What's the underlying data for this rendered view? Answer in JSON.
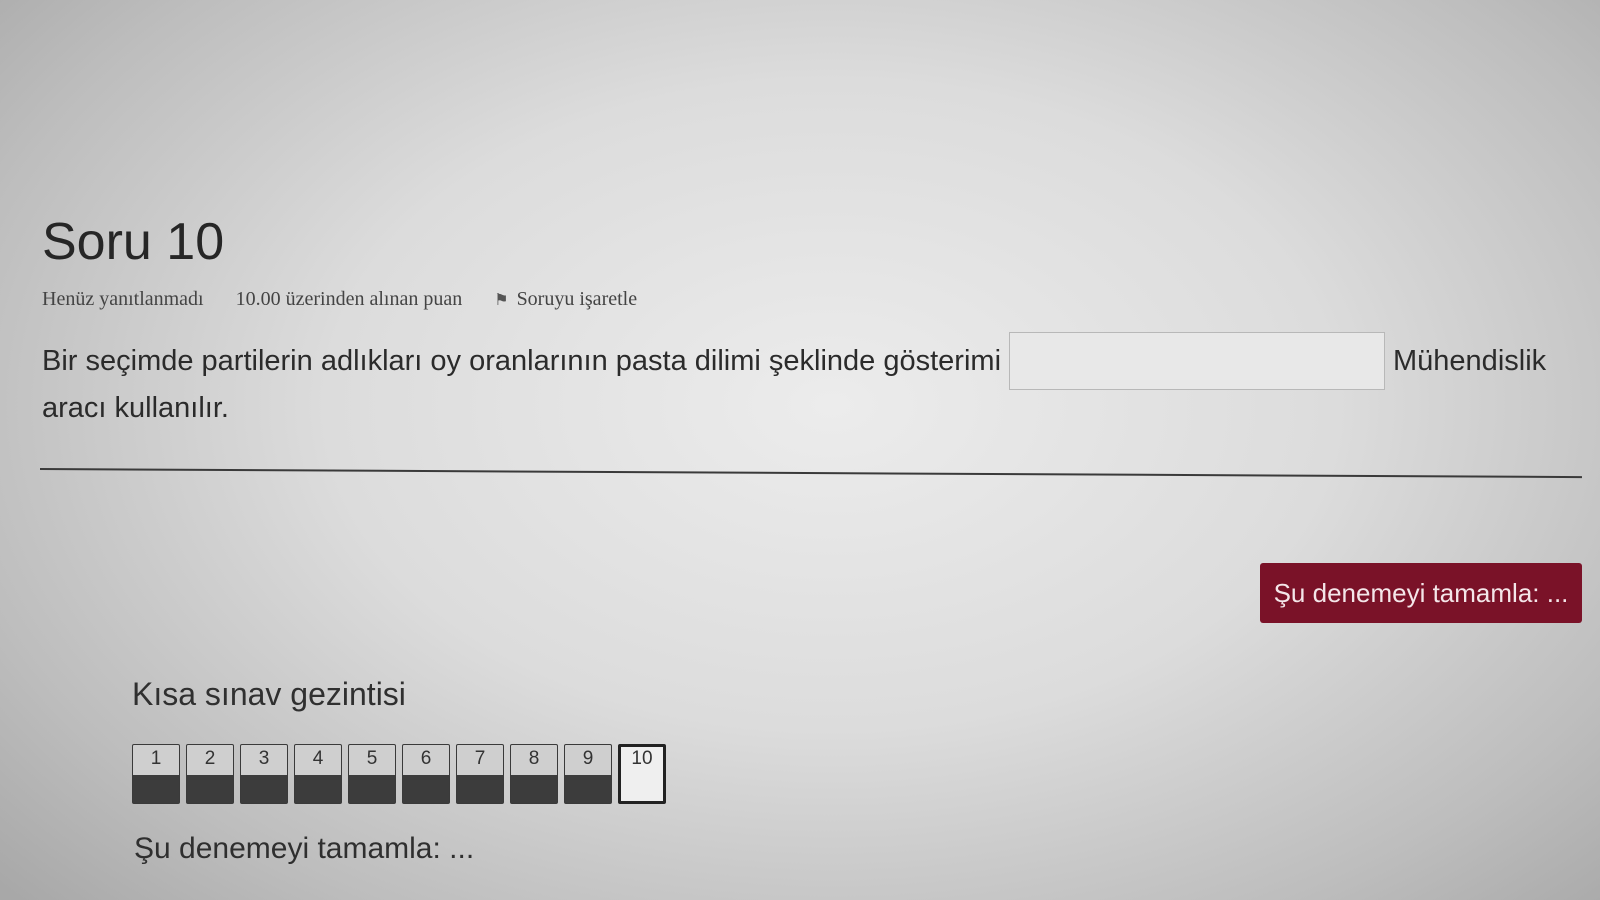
{
  "question": {
    "title": "Soru 10",
    "state": "Henüz yanıtlanmadı",
    "grade": "10.00 üzerinden alınan puan",
    "flag_label": "Soruyu işaretle",
    "text_before": "Bir seçimde partilerin adlıkları oy oranlarının pasta dilimi şeklinde gösterimi",
    "answer_value": "",
    "text_after": "Mühendislik",
    "text_line2": "aracı kullanılır."
  },
  "finish_button_label": "Şu denemeyi tamamla: ...",
  "navigation": {
    "title": "Kısa sınav gezintisi",
    "buttons": [
      {
        "label": "1"
      },
      {
        "label": "2"
      },
      {
        "label": "3"
      },
      {
        "label": "4"
      },
      {
        "label": "5"
      },
      {
        "label": "6"
      },
      {
        "label": "7"
      },
      {
        "label": "8"
      },
      {
        "label": "9"
      },
      {
        "label": "10"
      }
    ],
    "current": "10",
    "finish_link": "Şu denemeyi tamamla: ..."
  },
  "colors": {
    "finish_button_bg": "#7a1228",
    "answered_fill": "#3c3c3c"
  },
  "icons": {
    "flag": "flag-icon"
  }
}
